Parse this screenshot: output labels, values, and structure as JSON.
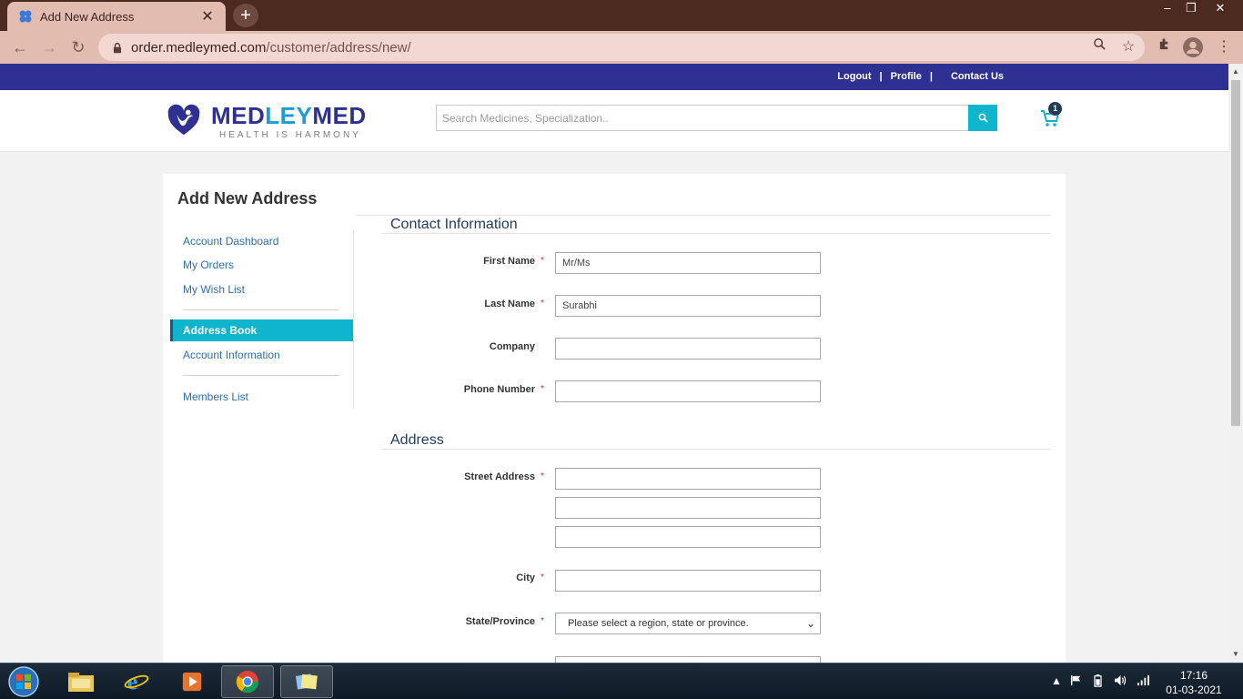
{
  "browser": {
    "tab_title": "Add New Address",
    "tab_close": "✕",
    "new_tab": "+",
    "url_host": "order.medleymed.com",
    "url_path": "/customer/address/new/",
    "window_controls": {
      "minimize": "–",
      "restore": "❐",
      "close": "✕"
    }
  },
  "site": {
    "top_links": {
      "logout": "Logout",
      "sep1": "|",
      "profile": "Profile",
      "sep2": "|",
      "contact": "Contact Us"
    },
    "logo": {
      "med": "MED",
      "ley": "LEY",
      "med2": "MED",
      "tagline": "HEALTH IS HARMONY"
    },
    "search": {
      "placeholder": "Search Medicines, Specialization.."
    },
    "cart": {
      "count": "1"
    },
    "colors": {
      "brand_navy": "#2e3192",
      "accent_teal": "#0eb5cc",
      "link_blue": "#2e6fb1",
      "required_red": "#e02b27"
    }
  },
  "page": {
    "title": "Add New Address"
  },
  "sidebar": {
    "items": [
      {
        "label": "Account Dashboard"
      },
      {
        "label": "My Orders"
      },
      {
        "label": "My Wish List"
      },
      {
        "label": "Address Book",
        "active": true
      },
      {
        "label": "Account Information"
      },
      {
        "label": "Members List"
      }
    ]
  },
  "form": {
    "required_mark": "*",
    "contact_section": "Contact Information",
    "address_section": "Address",
    "first_name": {
      "label": "First Name",
      "value": "Mr/Ms"
    },
    "last_name": {
      "label": "Last Name",
      "value": "Surabhi"
    },
    "company": {
      "label": "Company",
      "value": ""
    },
    "phone": {
      "label": "Phone Number",
      "value": ""
    },
    "street": {
      "label": "Street Address",
      "line1": "",
      "line2": "",
      "line3": ""
    },
    "city": {
      "label": "City",
      "value": ""
    },
    "state": {
      "label": "State/Province",
      "selected": "Please select a region, state or province."
    }
  },
  "taskbar": {
    "time": "17:16",
    "date": "01-03-2021"
  }
}
